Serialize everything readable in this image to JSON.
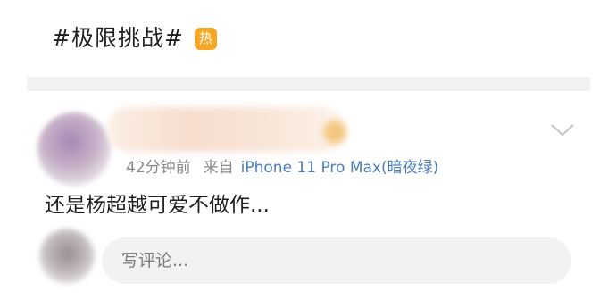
{
  "topic": {
    "text": "#极限挑战#",
    "hot_badge": "热",
    "badge_color": "#f5a623"
  },
  "post": {
    "time": "42分钟前",
    "source_prefix": "来自",
    "device": "iPhone 11 Pro Max(暗夜绿)",
    "device_color": "#4d7fb8",
    "body": "还是杨超越可爱不做作...",
    "menu_icon": "chevron-down-icon"
  },
  "comment": {
    "placeholder": "写评论..."
  }
}
